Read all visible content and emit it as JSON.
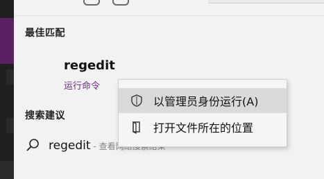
{
  "best_match": {
    "title": "最佳匹配",
    "app_name": "regedit",
    "app_subtitle": "运行命令"
  },
  "suggestions": {
    "title": "搜索建议",
    "items": [
      {
        "term": "regedit",
        "hint": "- 查看网络搜索结果"
      }
    ]
  },
  "context_menu": {
    "items": [
      {
        "label": "以管理员身份运行(A)",
        "icon": "shield-icon",
        "highlighted": true
      },
      {
        "label": "打开文件所在的位置",
        "icon": "folder-location-icon",
        "highlighted": false
      }
    ]
  },
  "colors": {
    "accent_purple": "#6b2a7d",
    "rail_accent": "#5b1f63",
    "menu_highlight": "#dadada"
  }
}
